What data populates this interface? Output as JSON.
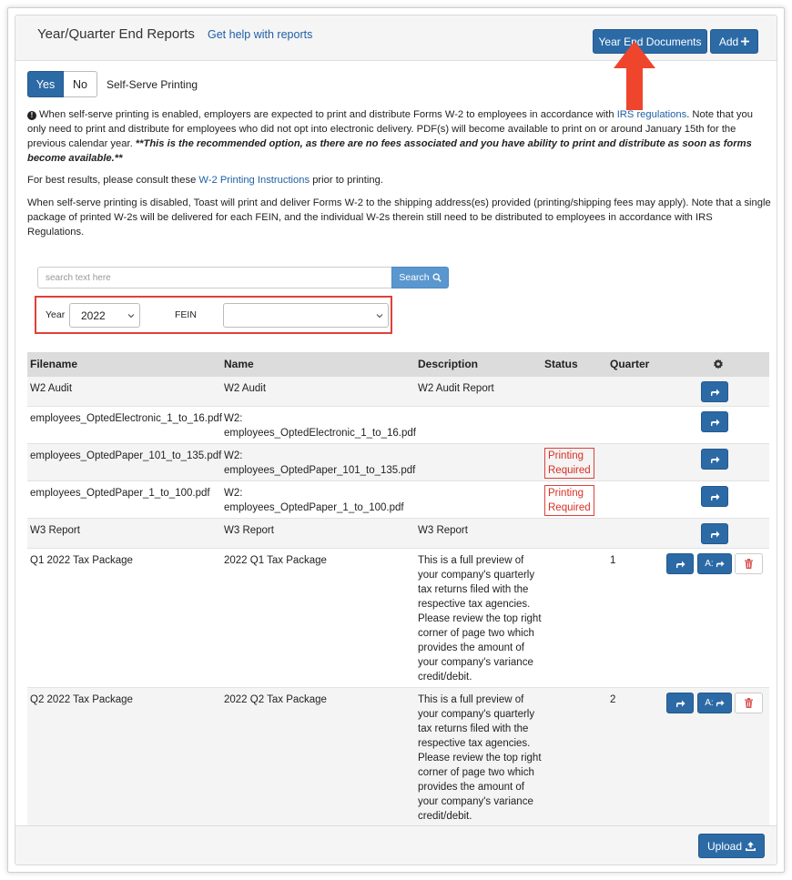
{
  "header": {
    "title": "Year/Quarter End Reports",
    "help_link": "Get help with reports",
    "year_end_documents": "Year End Documents",
    "add_button": "Add"
  },
  "toggle": {
    "yes": "Yes",
    "no": "No",
    "label": "Self-Serve Printing",
    "selected": "Yes"
  },
  "info": {
    "p1_a": "When self-serve printing is enabled, employers are expected to print and distribute Forms W-2 to employees in accordance with ",
    "p1_link": "IRS regulations",
    "p1_b": ". Note that you only need to print and distribute for employees who did not opt into electronic delivery. PDF(s) will become available to print on or around January 15th for the previous calendar year. ",
    "p1_bold": "**This is the recommended option, as there are no fees associated and you have ability to print and distribute as soon as forms become available.**",
    "p2_a": "For best results, please consult these ",
    "p2_link": "W-2 Printing Instructions",
    "p2_b": " prior to printing.",
    "p3": "When self-serve printing is disabled, Toast will print and deliver Forms W-2 to the shipping address(es) provided (printing/shipping fees may apply). Note that a single package of printed W-2s will be delivered for each FEIN, and the individual W-2s therein still need to be distributed to employees in accordance with IRS Regulations."
  },
  "search": {
    "placeholder": "search text here",
    "button": "Search"
  },
  "filters": {
    "year_label": "Year",
    "year_value": "2022",
    "fein_label": "FEIN",
    "fein_value": ""
  },
  "table": {
    "headers": [
      "Filename",
      "Name",
      "Description",
      "Status",
      "Quarter"
    ],
    "rows": [
      {
        "filename": "W2 Audit",
        "name": "W2 Audit",
        "description": "W2 Audit Report",
        "status": "",
        "quarter": ""
      },
      {
        "filename": "employees_OptedElectronic_1_to_16.pdf",
        "name": "W2: employees_OptedElectronic_1_to_16.pdf",
        "description": "",
        "status": "",
        "quarter": ""
      },
      {
        "filename": "employees_OptedPaper_101_to_135.pdf",
        "name": "W2: employees_OptedPaper_101_to_135.pdf",
        "description": "",
        "status": "Printing Required",
        "quarter": ""
      },
      {
        "filename": "employees_OptedPaper_1_to_100.pdf",
        "name": "W2: employees_OptedPaper_1_to_100.pdf",
        "description": "",
        "status": "Printing Required",
        "quarter": ""
      },
      {
        "filename": "W3 Report",
        "name": "W3 Report",
        "description": "W3 Report",
        "status": "",
        "quarter": ""
      },
      {
        "filename": "Q1 2022 Tax Package",
        "name": "2022 Q1 Tax Package",
        "description": "This is a full preview of your company's quarterly tax returns filed with the respective tax agencies. Please review the top right corner of page two which provides the amount of your company's variance credit/debit.",
        "status": "",
        "quarter": "1"
      },
      {
        "filename": "Q2 2022 Tax Package",
        "name": "2022 Q2 Tax Package",
        "description": "This is a full preview of your company's quarterly tax returns filed with the respective tax agencies. Please review the top right corner of page two which provides the amount of your company's variance credit/debit.",
        "status": "",
        "quarter": "2"
      }
    ],
    "a_button": "A:"
  },
  "footer": {
    "upload": "Upload"
  },
  "colors": {
    "primary": "#2c6aa6",
    "search_button": "#5b97cf",
    "annotation_red": "#e0403a",
    "delete_icon": "#d9534f"
  }
}
